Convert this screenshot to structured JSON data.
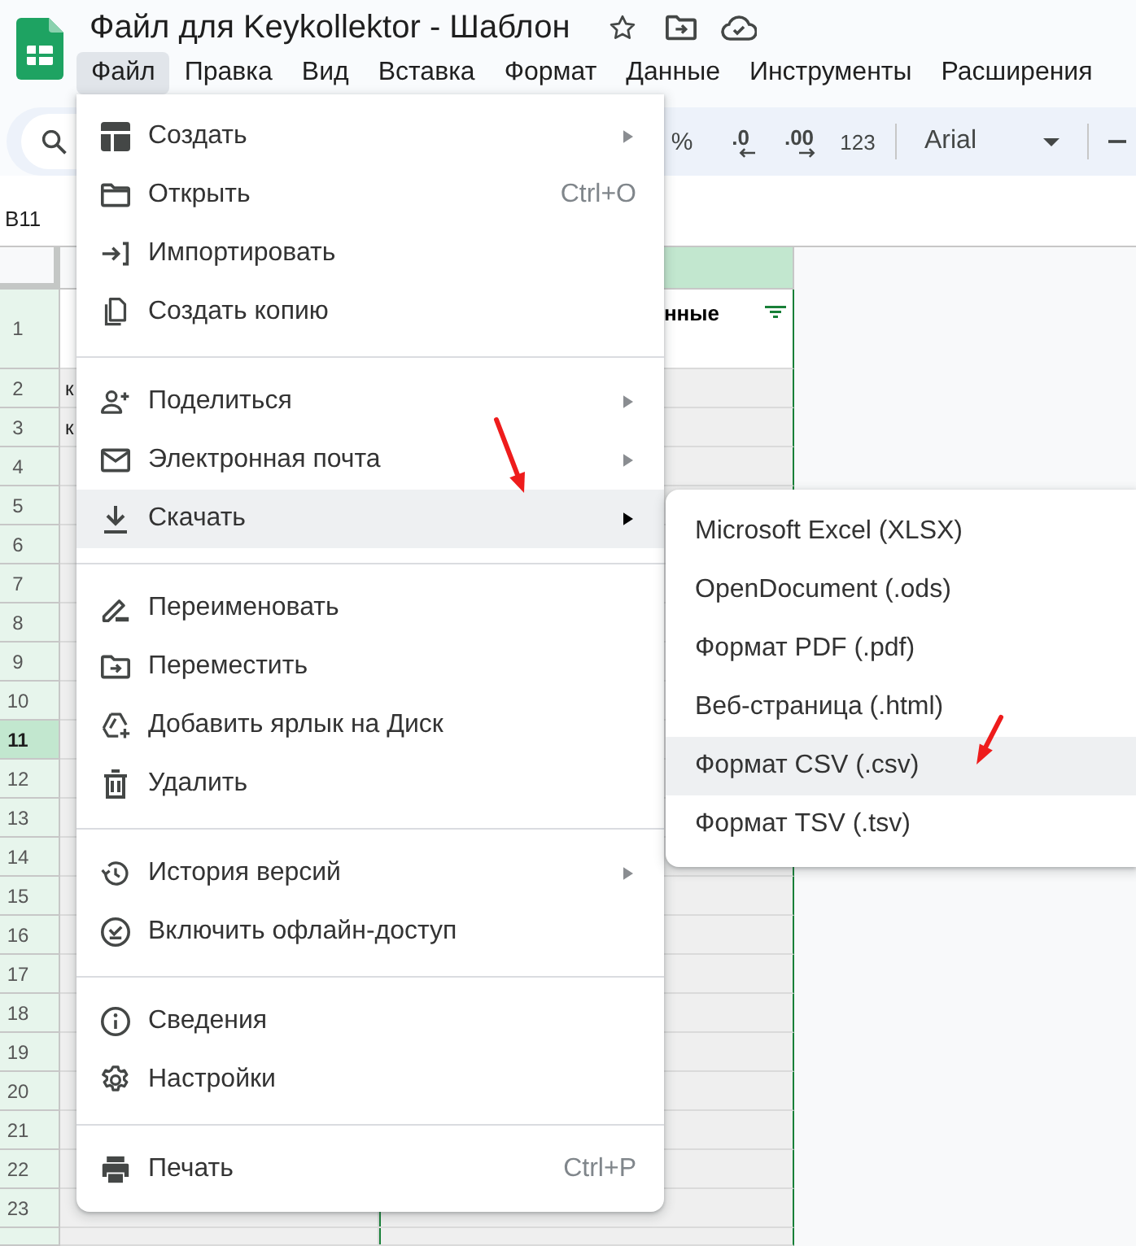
{
  "title": "Файл для Keykollektor - Шаблон",
  "menubar": [
    {
      "label": "Файл",
      "selected": true
    },
    {
      "label": "Правка",
      "selected": false
    },
    {
      "label": "Вид",
      "selected": false
    },
    {
      "label": "Вставка",
      "selected": false
    },
    {
      "label": "Формат",
      "selected": false
    },
    {
      "label": "Данные",
      "selected": false
    },
    {
      "label": "Инструменты",
      "selected": false
    },
    {
      "label": "Расширения",
      "selected": false
    }
  ],
  "toolbar": {
    "percent": "%",
    "decrease_decimal": ".0",
    "increase_decimal": ".00",
    "number_format": "123",
    "font": "Arial"
  },
  "name_box": "B11",
  "columns": [
    {
      "selected": false
    },
    {
      "selected": true
    }
  ],
  "rows": [
    {
      "kind": "header",
      "number": "1",
      "selected": false,
      "column_2": "нные"
    },
    {
      "kind": "data",
      "number": "2",
      "selected": false,
      "column_1": "к"
    },
    {
      "kind": "data",
      "number": "3",
      "selected": false,
      "column_1": "к"
    },
    {
      "kind": "data",
      "number": "4",
      "selected": false
    },
    {
      "kind": "data",
      "number": "5",
      "selected": false
    },
    {
      "kind": "data",
      "number": "6",
      "selected": false
    },
    {
      "kind": "data",
      "number": "7",
      "selected": false
    },
    {
      "kind": "data",
      "number": "8",
      "selected": false
    },
    {
      "kind": "data",
      "number": "9",
      "selected": false
    },
    {
      "kind": "data",
      "number": "10",
      "selected": false
    },
    {
      "kind": "data",
      "number": "11",
      "selected": true
    },
    {
      "kind": "data",
      "number": "12",
      "selected": false
    },
    {
      "kind": "data",
      "number": "13",
      "selected": false
    },
    {
      "kind": "data",
      "number": "14",
      "selected": false
    },
    {
      "kind": "data",
      "number": "15",
      "selected": false
    },
    {
      "kind": "data",
      "number": "16",
      "selected": false
    },
    {
      "kind": "data",
      "number": "17",
      "selected": false
    },
    {
      "kind": "data",
      "number": "18",
      "selected": false
    },
    {
      "kind": "data",
      "number": "19",
      "selected": false
    },
    {
      "kind": "data",
      "number": "20",
      "selected": false
    },
    {
      "kind": "data",
      "number": "21",
      "selected": false
    },
    {
      "kind": "data",
      "number": "22",
      "selected": false
    },
    {
      "kind": "data",
      "number": "23",
      "selected": false
    }
  ],
  "file_menu": {
    "groups": [
      [
        {
          "label": "Создать",
          "submenu": true,
          "selected": false
        },
        {
          "label": "Открыть",
          "shortcut": "Ctrl+O",
          "submenu": false,
          "selected": false
        },
        {
          "label": "Импортировать",
          "submenu": false,
          "selected": false
        },
        {
          "label": "Создать копию",
          "submenu": false,
          "selected": false
        }
      ],
      [
        {
          "label": "Поделиться",
          "submenu": true,
          "selected": false
        },
        {
          "label": "Электронная почта",
          "submenu": true,
          "selected": false
        },
        {
          "label": "Скачать",
          "submenu": true,
          "selected": true
        }
      ],
      [
        {
          "label": "Переименовать",
          "submenu": false,
          "selected": false
        },
        {
          "label": "Переместить",
          "submenu": false,
          "selected": false
        },
        {
          "label": "Добавить ярлык на Диск",
          "submenu": false,
          "selected": false
        },
        {
          "label": "Удалить",
          "submenu": false,
          "selected": false
        }
      ],
      [
        {
          "label": "История версий",
          "submenu": true,
          "selected": false
        },
        {
          "label": "Включить офлайн-доступ",
          "submenu": false,
          "selected": false
        }
      ],
      [
        {
          "label": "Сведения",
          "submenu": false,
          "selected": false
        },
        {
          "label": "Настройки",
          "submenu": false,
          "selected": false
        }
      ],
      [
        {
          "label": "Печать",
          "shortcut": "Ctrl+P",
          "submenu": false,
          "selected": false
        }
      ]
    ]
  },
  "download_submenu": [
    {
      "label": "Microsoft Excel (XLSX)",
      "selected": false
    },
    {
      "label": "OpenDocument (.ods)",
      "selected": false
    },
    {
      "label": "Формат PDF (.pdf)",
      "selected": false
    },
    {
      "label": "Веб-страница (.html)",
      "selected": false
    },
    {
      "label": "Формат CSV (.csv)",
      "selected": true
    },
    {
      "label": "Формат TSV (.tsv)",
      "selected": false
    }
  ]
}
